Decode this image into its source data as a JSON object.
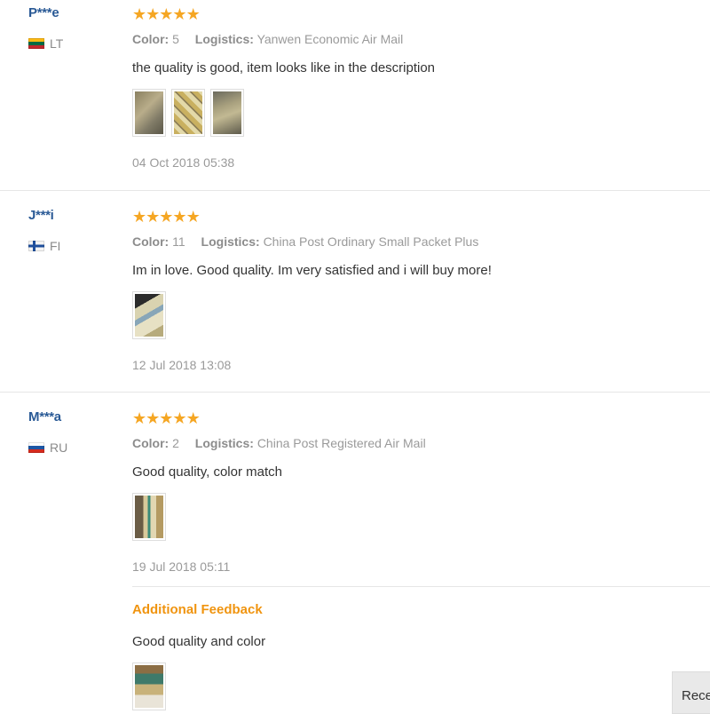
{
  "reviews": [
    {
      "user": "P***e",
      "country": "LT",
      "stars": [
        "★",
        "★",
        "★",
        "★",
        "★"
      ],
      "color_label": "Color:",
      "color_value": "5",
      "logistics_label": "Logistics:",
      "logistics_value": "Yanwen Economic Air Mail",
      "text": "the quality is good, item looks like in the description",
      "date": "04 Oct 2018 05:38"
    },
    {
      "user": "J***i",
      "country": "FI",
      "stars": [
        "★",
        "★",
        "★",
        "★",
        "★"
      ],
      "color_label": "Color:",
      "color_value": "11",
      "logistics_label": "Logistics:",
      "logistics_value": "China Post Ordinary Small Packet Plus",
      "text": "Im in love. Good quality. Im very satisfied and i will buy more!",
      "date": "12 Jul 2018 13:08"
    },
    {
      "user": "M***a",
      "country": "RU",
      "stars": [
        "★",
        "★",
        "★",
        "★",
        "★"
      ],
      "color_label": "Color:",
      "color_value": "2",
      "logistics_label": "Logistics:",
      "logistics_value": "China Post Registered Air Mail",
      "text": "Good quality, color match",
      "date": "19 Jul 2018 05:11",
      "additional": {
        "title": "Additional Feedback",
        "text": "Good quality and color"
      }
    }
  ],
  "recent_button": "Recent",
  "colors": {
    "username": "#2a5a96",
    "star": "#f5a623",
    "additional_title": "#f0940f"
  }
}
